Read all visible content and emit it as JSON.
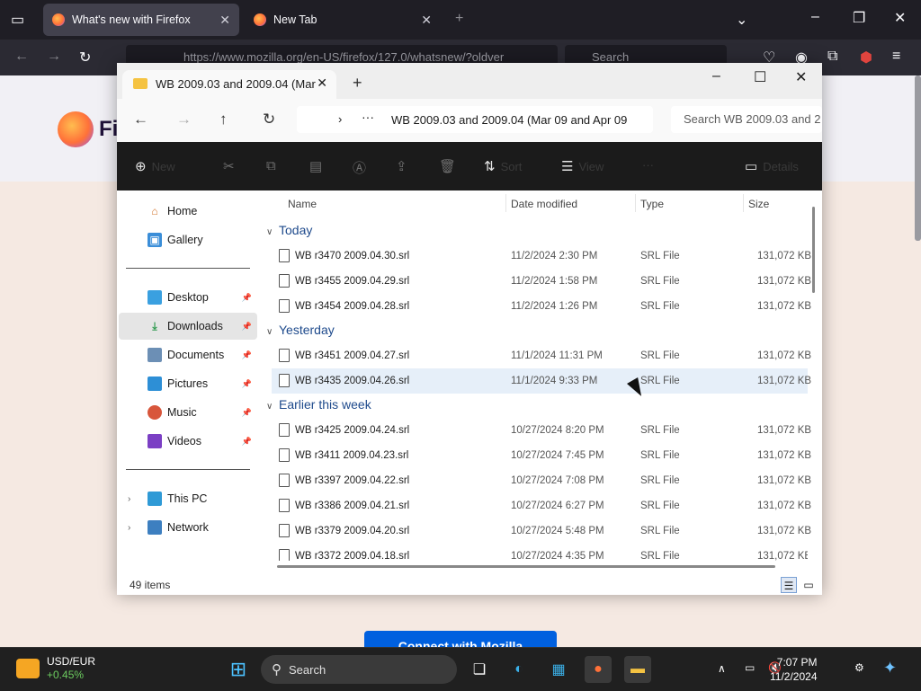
{
  "browser": {
    "tabs": [
      {
        "label": "What's new with Firefox",
        "active": true
      },
      {
        "label": "New Tab",
        "active": false
      }
    ],
    "url": "https://www.mozilla.org/en-US/firefox/127.0/whatsnew/?oldver",
    "search_placeholder": "Search",
    "page_brand": "Fi",
    "cta_label": "Connect with Mozilla"
  },
  "explorer": {
    "tab_label": "WB 2009.03 and 2009.04 (Mar",
    "address": "WB 2009.03 and 2009.04 (Mar 09 and Apr 09",
    "search_placeholder": "Search WB 2009.03 and 2",
    "toolbar": {
      "new": "New",
      "sort": "Sort",
      "view": "View",
      "more": "···",
      "details": "Details"
    },
    "nav": [
      {
        "label": "Home",
        "icon": "home-icon"
      },
      {
        "label": "Gallery",
        "icon": "gallery-icon"
      },
      {
        "label": "Desktop",
        "icon": "desktop-icon",
        "pinned": true
      },
      {
        "label": "Downloads",
        "icon": "download-icon",
        "pinned": true,
        "selected": true
      },
      {
        "label": "Documents",
        "icon": "documents-icon",
        "pinned": true
      },
      {
        "label": "Pictures",
        "icon": "pictures-icon",
        "pinned": true
      },
      {
        "label": "Music",
        "icon": "music-icon",
        "pinned": true
      },
      {
        "label": "Videos",
        "icon": "videos-icon",
        "pinned": true
      },
      {
        "label": "This PC",
        "icon": "pc-icon"
      },
      {
        "label": "Network",
        "icon": "network-icon"
      }
    ],
    "columns": {
      "name": "Name",
      "date": "Date modified",
      "type": "Type",
      "size": "Size"
    },
    "groups": [
      {
        "label": "Today",
        "files": [
          {
            "name": "WB r3470 2009.04.30.srl",
            "date": "11/2/2024 2:30 PM",
            "type": "SRL File",
            "size": "131,072 KB"
          },
          {
            "name": "WB r3455 2009.04.29.srl",
            "date": "11/2/2024 1:58 PM",
            "type": "SRL File",
            "size": "131,072 KB"
          },
          {
            "name": "WB r3454 2009.04.28.srl",
            "date": "11/2/2024 1:26 PM",
            "type": "SRL File",
            "size": "131,072 KB"
          }
        ]
      },
      {
        "label": "Yesterday",
        "files": [
          {
            "name": "WB r3451 2009.04.27.srl",
            "date": "11/1/2024 11:31 PM",
            "type": "SRL File",
            "size": "131,072 KB"
          },
          {
            "name": "WB r3435 2009.04.26.srl",
            "date": "11/1/2024 9:33 PM",
            "type": "SRL File",
            "size": "131,072 KB"
          }
        ]
      },
      {
        "label": "Earlier this week",
        "files": [
          {
            "name": "WB r3425 2009.04.24.srl",
            "date": "10/27/2024 8:20 PM",
            "type": "SRL File",
            "size": "131,072 KB"
          },
          {
            "name": "WB r3411 2009.04.23.srl",
            "date": "10/27/2024 7:45 PM",
            "type": "SRL File",
            "size": "131,072 KB"
          },
          {
            "name": "WB r3397 2009.04.22.srl",
            "date": "10/27/2024 7:08 PM",
            "type": "SRL File",
            "size": "131,072 KB"
          },
          {
            "name": "WB r3386 2009.04.21.srl",
            "date": "10/27/2024 6:27 PM",
            "type": "SRL File",
            "size": "131,072 KB"
          },
          {
            "name": "WB r3379 2009.04.20.srl",
            "date": "10/27/2024 5:48 PM",
            "type": "SRL File",
            "size": "131,072 KB"
          },
          {
            "name": "WB r3372 2009.04.18.srl",
            "date": "10/27/2024 4:35 PM",
            "type": "SRL File",
            "size": "131,072 KB"
          }
        ]
      }
    ],
    "status": "49 items"
  },
  "taskbar": {
    "weather_title": "USD/EUR",
    "weather_value": "+0.45%",
    "search_label": "Search",
    "time": "7:07 PM",
    "date": "11/2/2024"
  }
}
